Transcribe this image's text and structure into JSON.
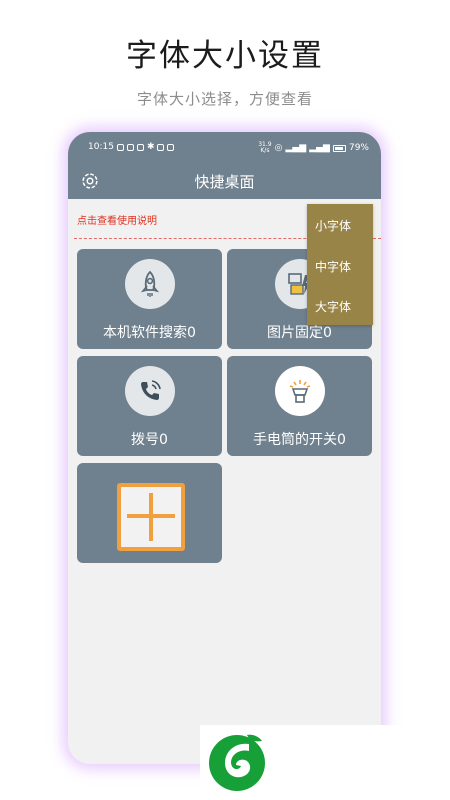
{
  "promo": {
    "title": "字体大小设置",
    "subtitle": "字体大小选择，方便查看"
  },
  "status_bar": {
    "time": "10:15",
    "speed_value": "31.9",
    "speed_unit": "K/s",
    "battery": "79%"
  },
  "app": {
    "title": "快捷桌面",
    "usage_link": "点击查看使用说明"
  },
  "font_menu": {
    "items": [
      "小字体",
      "中字体",
      "大字体"
    ]
  },
  "tiles": [
    {
      "label": "本机软件搜索0",
      "icon": "rocket-icon"
    },
    {
      "label": "图片固定0",
      "icon": "image-pin-icon"
    },
    {
      "label": "拨号0",
      "icon": "phone-icon"
    },
    {
      "label": "手电筒的开关0",
      "icon": "flashlight-icon"
    },
    {
      "label": "",
      "icon": "add-icon"
    }
  ],
  "colors": {
    "header": "#6f808e",
    "tile": "#6f808e",
    "menu": "#998448",
    "link": "#e0301e",
    "add_accent": "#f0a03e",
    "logo_green": "#17a037"
  }
}
